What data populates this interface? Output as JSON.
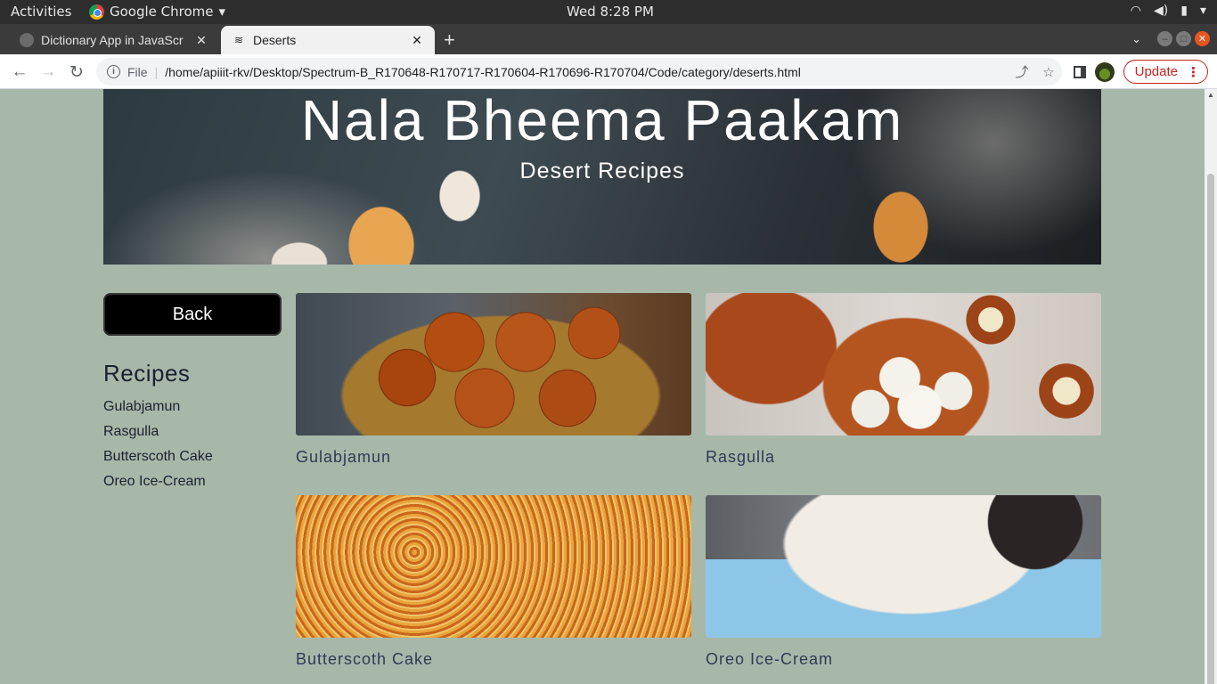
{
  "os_bar": {
    "activities": "Activities",
    "app_name": "Google Chrome",
    "clock": "Wed  8:28 PM"
  },
  "tabs": [
    {
      "title": "Dictionary App in JavaScr",
      "active": false
    },
    {
      "title": "Deserts",
      "active": true
    }
  ],
  "toolbar": {
    "scheme": "File",
    "url": "/home/apiiit-rkv/Desktop/Spectrum-B_R170648-R170717-R170604-R170696-R170704/Code/category/deserts.html",
    "update_label": "Update"
  },
  "hero": {
    "title": "Nala Bheema Paakam",
    "subtitle": "Desert Recipes"
  },
  "sidebar": {
    "back_label": "Back",
    "heading": "Recipes",
    "links": [
      "Gulabjamun",
      "Rasgulla",
      "Butterscoth Cake",
      "Oreo Ice-Cream"
    ]
  },
  "cards": [
    {
      "label": "Gulabjamun",
      "image": "gulabjamun-photo"
    },
    {
      "label": "Rasgulla",
      "image": "rasgulla-photo"
    },
    {
      "label": "Butterscoth Cake",
      "image": "butterscotch-cake-photo"
    },
    {
      "label": "Oreo Ice-Cream",
      "image": "oreo-ice-cream-photo"
    }
  ],
  "colors": {
    "page_background": "#a7b8a9",
    "card_label": "#2e3a55",
    "update_accent": "#c5221f"
  }
}
